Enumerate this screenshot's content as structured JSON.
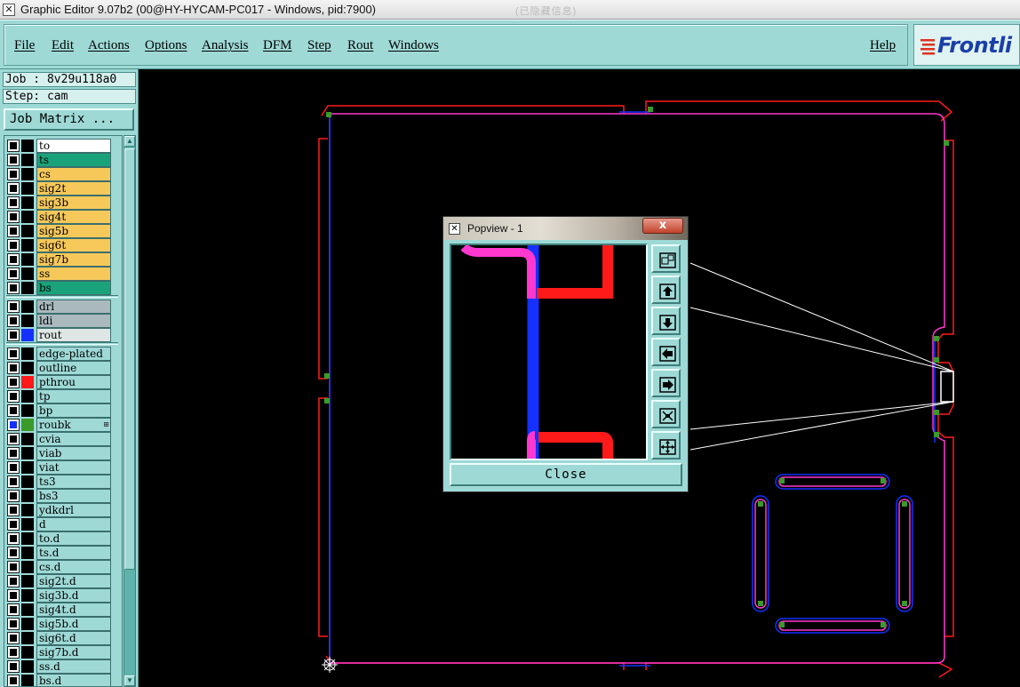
{
  "window": {
    "title": "Graphic Editor 9.07b2 (00@HY-HYCAM-PC017 - Windows, pid:7900)",
    "title_right": "(已隐藏信息)"
  },
  "menu": {
    "items": [
      "File",
      "Edit",
      "Actions",
      "Options",
      "Analysis",
      "DFM",
      "Step",
      "Rout",
      "Windows"
    ],
    "help": "Help"
  },
  "logo": {
    "text": "Frontli"
  },
  "left": {
    "job": "Job : 8v29u118a0",
    "step": "Step: cam",
    "job_matrix": "Job Matrix ..."
  },
  "layers": [
    {
      "name": "to",
      "bg": "#ffffff",
      "swatch": "#000000",
      "group": 1
    },
    {
      "name": "ts",
      "bg": "#1aa37a",
      "swatch": "#000000",
      "group": 1
    },
    {
      "name": "cs",
      "bg": "#f6c85a",
      "swatch": "#000000",
      "group": 1
    },
    {
      "name": "sig2t",
      "bg": "#f6c85a",
      "swatch": "#000000",
      "group": 1
    },
    {
      "name": "sig3b",
      "bg": "#f6c85a",
      "swatch": "#000000",
      "group": 1
    },
    {
      "name": "sig4t",
      "bg": "#f6c85a",
      "swatch": "#000000",
      "group": 1
    },
    {
      "name": "sig5b",
      "bg": "#f6c85a",
      "swatch": "#000000",
      "group": 1
    },
    {
      "name": "sig6t",
      "bg": "#f6c85a",
      "swatch": "#000000",
      "group": 1
    },
    {
      "name": "sig7b",
      "bg": "#f6c85a",
      "swatch": "#000000",
      "group": 1
    },
    {
      "name": "ss",
      "bg": "#f6c85a",
      "swatch": "#000000",
      "group": 1
    },
    {
      "name": "bs",
      "bg": "#1aa37a",
      "swatch": "#000000",
      "group": 1
    },
    {
      "name": "drl",
      "bg": "#a9b9be",
      "swatch": "#000000",
      "group": 2
    },
    {
      "name": "ldi",
      "bg": "#a9b9be",
      "swatch": "#000000",
      "group": 2
    },
    {
      "name": "rout",
      "bg": "#dfe7e6",
      "swatch": "#1630ff",
      "group": 2
    },
    {
      "name": "edge-plated",
      "bg": "#9ed9d6",
      "swatch": "#000000",
      "group": 3
    },
    {
      "name": "outline",
      "bg": "#9ed9d6",
      "swatch": "#000000",
      "group": 3
    },
    {
      "name": "pthrou",
      "bg": "#9ed9d6",
      "swatch": "#ff1a1a",
      "group": 3
    },
    {
      "name": "tp",
      "bg": "#9ed9d6",
      "swatch": "#000000",
      "group": 3
    },
    {
      "name": "bp",
      "bg": "#9ed9d6",
      "swatch": "#000000",
      "group": 3
    },
    {
      "name": "roubk",
      "bg": "#9ed9d6",
      "swatch": "#3a9a2a",
      "group": 3
    },
    {
      "name": "cvia",
      "bg": "#9ed9d6",
      "swatch": "#000000",
      "group": 3
    },
    {
      "name": "viab",
      "bg": "#9ed9d6",
      "swatch": "#000000",
      "group": 3
    },
    {
      "name": "viat",
      "bg": "#9ed9d6",
      "swatch": "#000000",
      "group": 3
    },
    {
      "name": "ts3",
      "bg": "#9ed9d6",
      "swatch": "#000000",
      "group": 3
    },
    {
      "name": "bs3",
      "bg": "#9ed9d6",
      "swatch": "#000000",
      "group": 3
    },
    {
      "name": "ydkdrl",
      "bg": "#9ed9d6",
      "swatch": "#000000",
      "group": 3
    },
    {
      "name": "d",
      "bg": "#9ed9d6",
      "swatch": "#000000",
      "group": 3
    },
    {
      "name": "to.d",
      "bg": "#9ed9d6",
      "swatch": "#000000",
      "group": 3
    },
    {
      "name": "ts.d",
      "bg": "#9ed9d6",
      "swatch": "#000000",
      "group": 3
    },
    {
      "name": "cs.d",
      "bg": "#9ed9d6",
      "swatch": "#000000",
      "group": 3
    },
    {
      "name": "sig2t.d",
      "bg": "#9ed9d6",
      "swatch": "#000000",
      "group": 3
    },
    {
      "name": "sig3b.d",
      "bg": "#9ed9d6",
      "swatch": "#000000",
      "group": 3
    },
    {
      "name": "sig4t.d",
      "bg": "#9ed9d6",
      "swatch": "#000000",
      "group": 3
    },
    {
      "name": "sig5b.d",
      "bg": "#9ed9d6",
      "swatch": "#000000",
      "group": 3
    },
    {
      "name": "sig6t.d",
      "bg": "#9ed9d6",
      "swatch": "#000000",
      "group": 3
    },
    {
      "name": "sig7b.d",
      "bg": "#9ed9d6",
      "swatch": "#000000",
      "group": 3
    },
    {
      "name": "ss.d",
      "bg": "#9ed9d6",
      "swatch": "#000000",
      "group": 3
    },
    {
      "name": "bs.d",
      "bg": "#9ed9d6",
      "swatch": "#000000",
      "group": 3
    }
  ],
  "popview": {
    "title": "Popview - 1",
    "close_x": "x",
    "close": "Close",
    "tools": [
      "fit-icon",
      "move-up-icon",
      "move-down-icon",
      "move-left-icon",
      "move-right-icon",
      "zoom-in-icon",
      "zoom-out-icon"
    ]
  },
  "colors": {
    "panel": "#9ed9d6",
    "rout": "#1630ff",
    "outline": "#ff1a1a",
    "magenta": "#ff38d0",
    "pad": "#3a9a2a"
  }
}
